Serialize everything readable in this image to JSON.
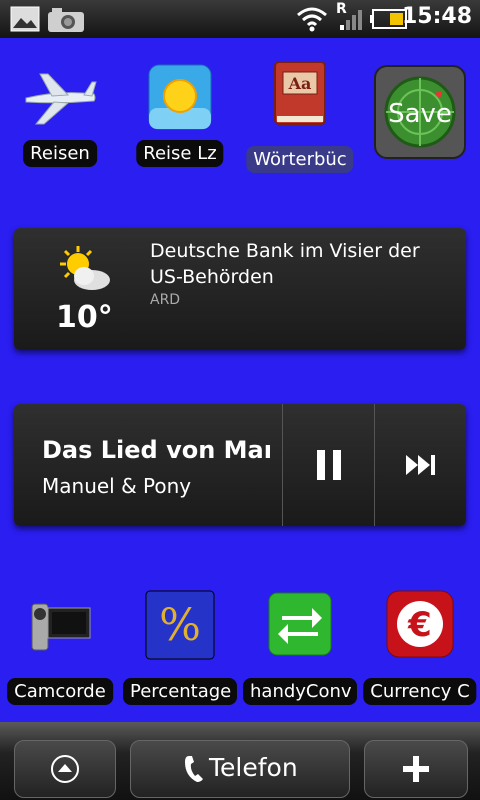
{
  "status_bar": {
    "time": "15:48",
    "network_letter": "R",
    "icons": [
      "gallery-icon",
      "camera-icon",
      "wifi-icon",
      "signal-icon",
      "battery-icon"
    ]
  },
  "top_apps": [
    {
      "label": "Reisen",
      "icon": "airplane-icon"
    },
    {
      "label": "Reise Lz",
      "icon": "sun-icon"
    },
    {
      "label": "Wörterbüc",
      "icon": "dictionary-icon"
    },
    {
      "label": "",
      "icon": "save-radar-icon",
      "icon_text": "Save"
    }
  ],
  "news_widget": {
    "temperature": "10°",
    "headline": "Deutsche Bank im Visier der US-Behörden",
    "source": "ARD"
  },
  "music_widget": {
    "title": "Das Lied von Man",
    "artist": "Manuel & Pony"
  },
  "bottom_apps": [
    {
      "label": "Camcorde",
      "icon": "camcorder-icon"
    },
    {
      "label": "Percentage",
      "icon": "percent-icon",
      "icon_text": "%"
    },
    {
      "label": "handyConv",
      "icon": "arrows-icon"
    },
    {
      "label": "Currency C",
      "icon": "euro-icon",
      "icon_text": "€"
    }
  ],
  "dock": {
    "phone_label": "Telefon"
  },
  "colors": {
    "wallpaper": "#2a1ef0",
    "widget": "#222222"
  }
}
